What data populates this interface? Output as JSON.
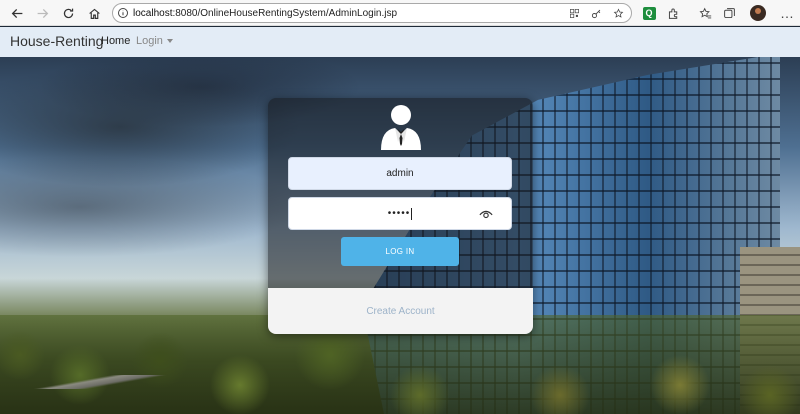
{
  "browser": {
    "url_host": "localhost",
    "url_rest": ":8080/OnlineHouseRentingSystem/AdminLogin.jsp",
    "icons": [
      "back-icon",
      "forward-icon",
      "reload-icon",
      "home-icon",
      "info-icon",
      "qr-icon",
      "key-icon",
      "favorite-icon",
      "extension-q-icon",
      "puzzle-icon",
      "favorites-icon",
      "collections-icon",
      "profile-avatar",
      "menu-icon"
    ],
    "ext_q_label": "Q",
    "menu_label": "…"
  },
  "navbar": {
    "brand": "House-Renting",
    "home": "Home",
    "login": "Login"
  },
  "login_form": {
    "username_value": "admin",
    "password_value": "•••••",
    "login_button": "LOG IN",
    "create_account": "Create Account"
  },
  "colors": {
    "navbar_bg": "#e3ecf6",
    "login_button": "#4fb3e8",
    "username_bg": "#e8f0fe",
    "create_account_text": "#9db3c9"
  }
}
